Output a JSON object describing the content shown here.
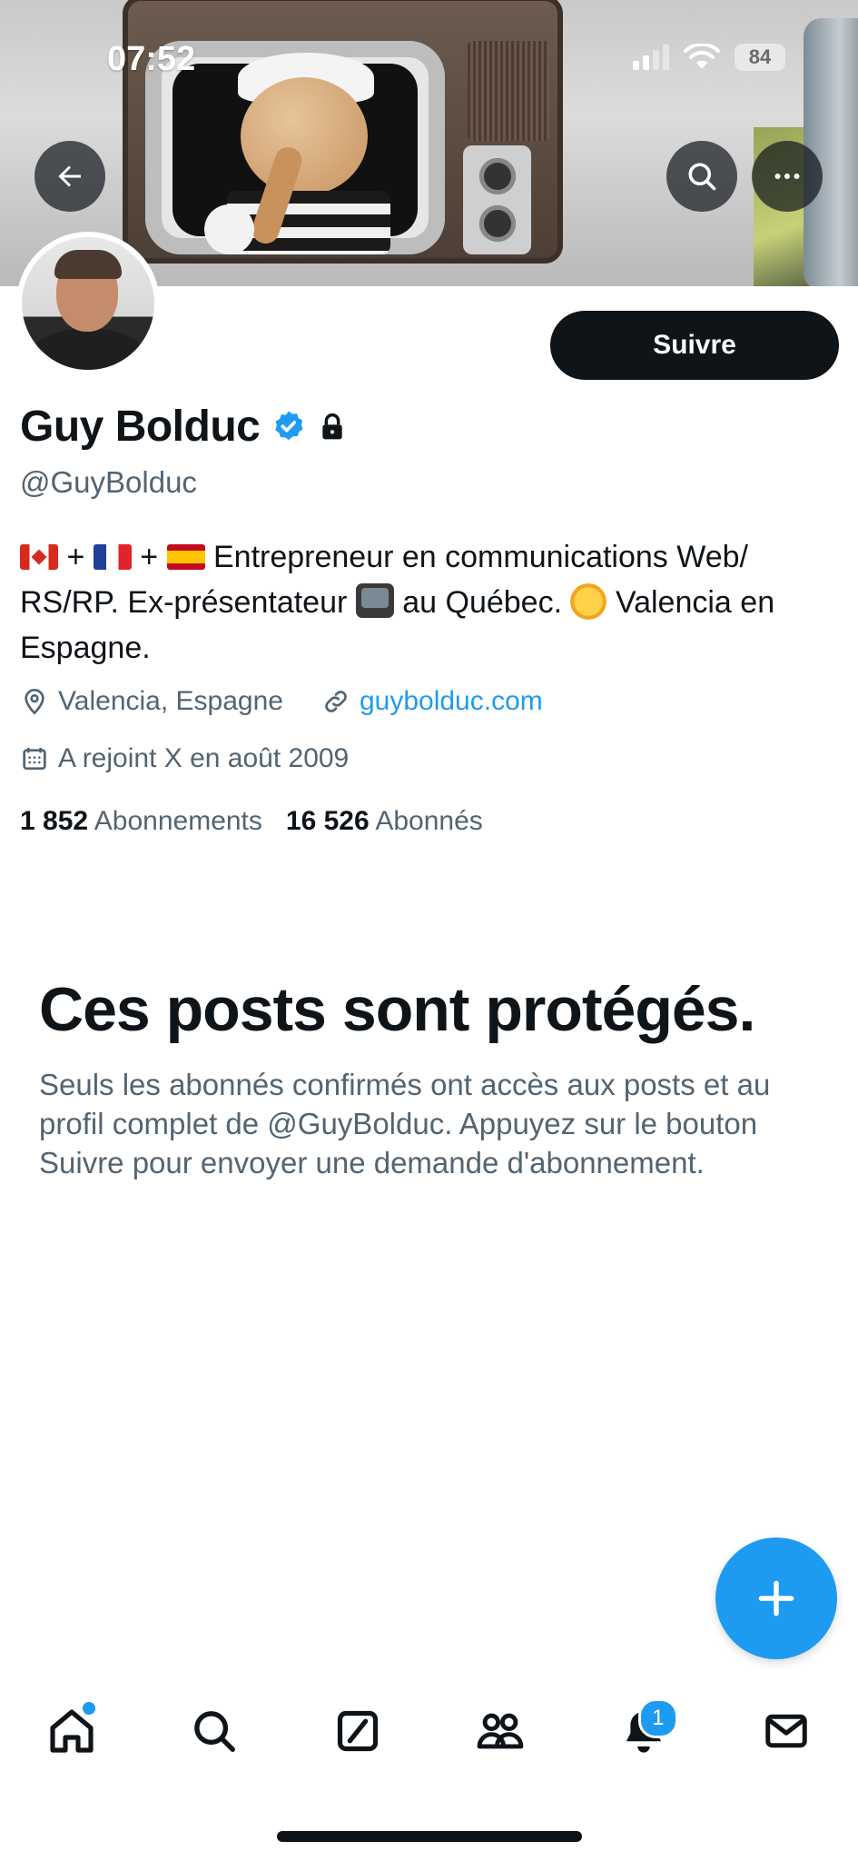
{
  "status_bar": {
    "time": "07:52",
    "battery": "84"
  },
  "profile": {
    "name": "Guy Bolduc",
    "handle": "@GuyBolduc",
    "follow_label": "Suivre",
    "bio_plus_1": "+",
    "bio_plus_2": "+",
    "bio_text_1": "Entrepreneur en communications Web/ RS/RP. Ex-présentateur",
    "bio_text_2": "au Québec.",
    "bio_text_3": "Valencia en Espagne.",
    "location": "Valencia, Espagne",
    "website": "guybolduc.com",
    "joined": "A rejoint X en août 2009",
    "following_count": "1 852",
    "following_label": "Abonnements",
    "followers_count": "16 526",
    "followers_label": "Abonnés"
  },
  "protected": {
    "title": "Ces posts sont protégés.",
    "text": "Seuls les abonnés confirmés ont accès aux posts et au profil complet de @GuyBolduc. Appuyez sur le bouton Suivre pour envoyer une demande d'abonnement."
  },
  "tabbar": {
    "notifications_badge": "1"
  },
  "colors": {
    "accent": "#1d9bf0",
    "text": "#0f1419",
    "muted": "#536471"
  },
  "icons": [
    "back-arrow-icon",
    "search-icon",
    "more-icon",
    "verified-badge-icon",
    "lock-icon",
    "location-icon",
    "link-icon",
    "calendar-icon",
    "plus-icon",
    "home-icon",
    "explore-icon",
    "grok-icon",
    "communities-icon",
    "notifications-icon",
    "messages-icon"
  ]
}
